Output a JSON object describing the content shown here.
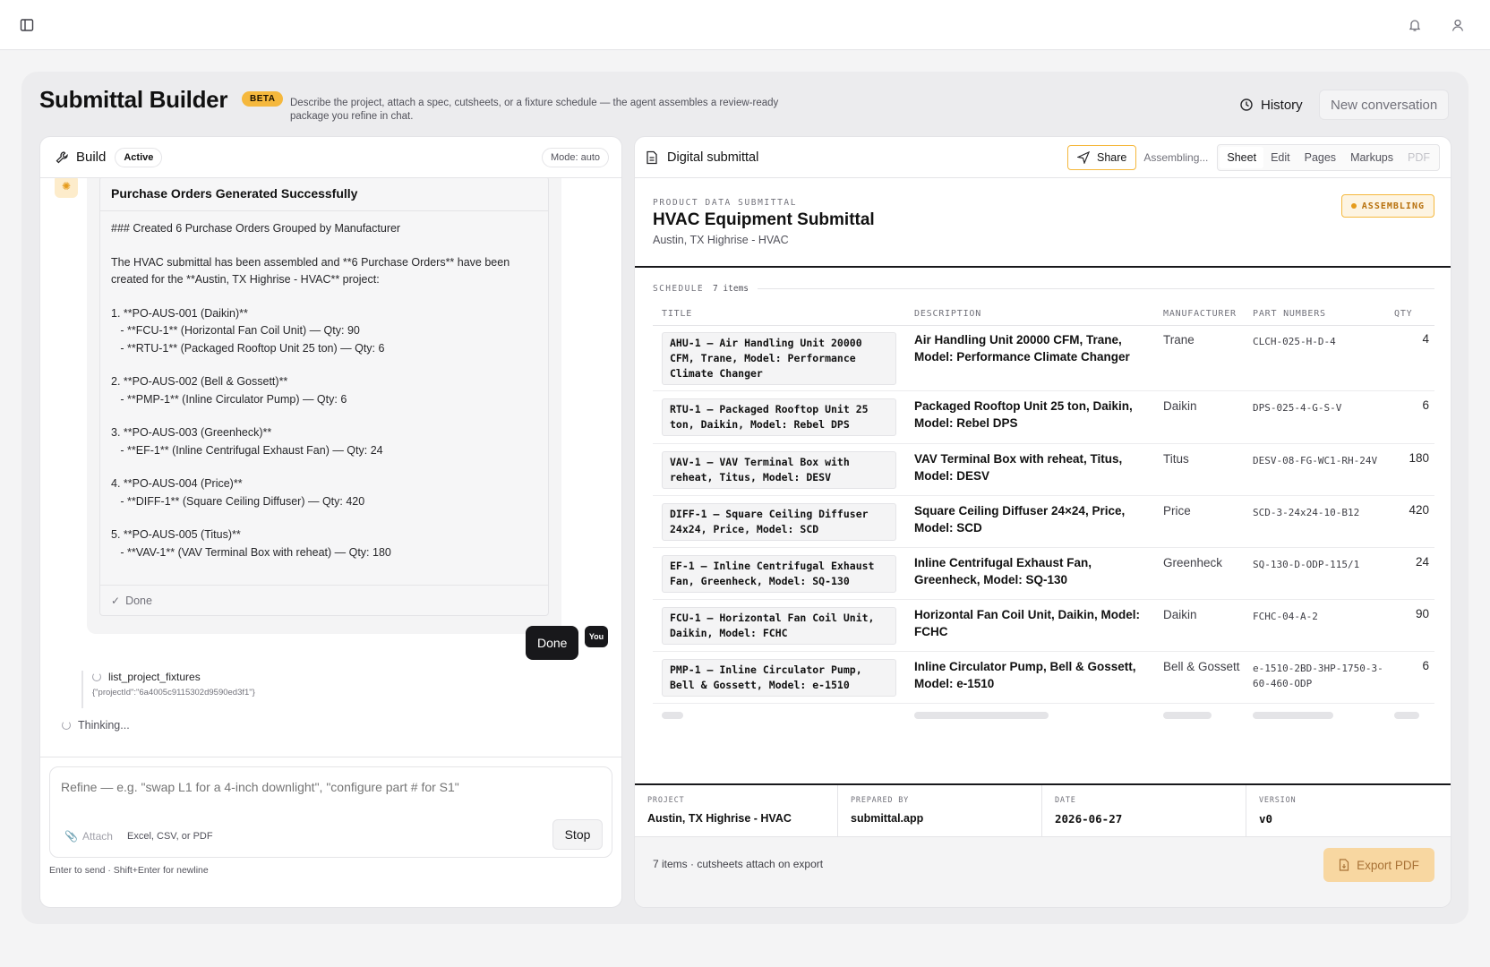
{
  "header": {
    "title": "Submittal Builder",
    "badge": "BETA",
    "description": "Describe the project, attach a spec, cutsheets, or a fixture schedule — the agent assembles a review-ready package you refine in chat.",
    "history_label": "History",
    "new_conversation_label": "New conversation"
  },
  "build": {
    "title": "Build",
    "status": "Active",
    "mode": "Mode: auto",
    "card_title": "Purchase Orders Generated Successfully",
    "card_lines": [
      "### Created 6 Purchase Orders Grouped by Manufacturer",
      "",
      "The HVAC submittal has been assembled and **6 Purchase Orders** have been",
      "created for the **Austin, TX Highrise - HVAC** project:",
      "",
      "1. **PO-AUS-001 (Daikin)**",
      "   - **FCU-1** (Horizontal Fan Coil Unit) — Qty: 90",
      "   - **RTU-1** (Packaged Rooftop Unit 25 ton) — Qty: 6",
      "",
      "2. **PO-AUS-002 (Bell & Gossett)**",
      "   - **PMP-1** (Inline Circulator Pump) — Qty: 6",
      "",
      "3. **PO-AUS-003 (Greenheck)**",
      "   - **EF-1** (Inline Centrifugal Exhaust Fan) — Qty: 24",
      "",
      "4. **PO-AUS-004 (Price)**",
      "   - **DIFF-1** (Square Ceiling Diffuser) — Qty: 420",
      "",
      "5. **PO-AUS-005 (Titus)**",
      "   - **VAV-1** (VAV Terminal Box with reheat) — Qty: 180"
    ],
    "card_footer": "Done",
    "user_message": "Done",
    "user_avatar": "You",
    "tool_name": "list_project_fixtures",
    "tool_args": "{\"projectId\":\"6a4005c9115302d9590ed3f1\"}",
    "thinking": "Thinking...",
    "input_placeholder": "Refine — e.g. \"swap L1 for a 4-inch downlight\", \"configure part # for S1\"",
    "attach_label": "Attach",
    "attach_hint": "Excel, CSV, or PDF",
    "stop_label": "Stop",
    "footer_hint": "Enter to send · Shift+Enter for newline"
  },
  "submittal": {
    "title": "Digital submittal",
    "share_label": "Share",
    "assembling_label": "Assembling...",
    "tabs": [
      "Sheet",
      "Edit",
      "Pages",
      "Markups",
      "PDF"
    ],
    "kicker": "PRODUCT DATA SUBMITTAL",
    "doc_title": "HVAC Equipment Submittal",
    "doc_subtitle": "Austin, TX Highrise - HVAC",
    "status_badge": "ASSEMBLING",
    "schedule_label": "SCHEDULE",
    "schedule_count": "7 items",
    "columns": [
      "TITLE",
      "DESCRIPTION",
      "MANUFACTURER",
      "PART NUMBERS",
      "QTY"
    ],
    "rows": [
      {
        "title": "AHU-1 — Air Handling Unit 20000 CFM, Trane, Model: Performance Climate Changer",
        "description": "Air Handling Unit 20000 CFM, Trane, Model: Performance Climate Changer",
        "manufacturer": "Trane",
        "part": "CLCH-025-H-D-4",
        "qty": "4"
      },
      {
        "title": "RTU-1 — Packaged Rooftop Unit 25 ton, Daikin, Model: Rebel DPS",
        "description": "Packaged Rooftop Unit 25 ton, Daikin, Model: Rebel DPS",
        "manufacturer": "Daikin",
        "part": "DPS-025-4-G-S-V",
        "qty": "6"
      },
      {
        "title": "VAV-1 — VAV Terminal Box with reheat, Titus, Model: DESV",
        "description": "VAV Terminal Box with reheat, Titus, Model: DESV",
        "manufacturer": "Titus",
        "part": "DESV-08-FG-WC1-RH-24V",
        "qty": "180"
      },
      {
        "title": "DIFF-1 — Square Ceiling Diffuser 24x24, Price, Model: SCD",
        "description": "Square Ceiling Diffuser 24×24, Price, Model: SCD",
        "manufacturer": "Price",
        "part": "SCD-3-24x24-10-B12",
        "qty": "420"
      },
      {
        "title": "EF-1 — Inline Centrifugal Exhaust Fan, Greenheck, Model: SQ-130",
        "description": "Inline Centrifugal Exhaust Fan, Greenheck, Model: SQ-130",
        "manufacturer": "Greenheck",
        "part": "SQ-130-D-ODP-115/1",
        "qty": "24"
      },
      {
        "title": "FCU-1 — Horizontal Fan Coil Unit, Daikin, Model: FCHC",
        "description": "Horizontal Fan Coil Unit, Daikin, Model: FCHC",
        "manufacturer": "Daikin",
        "part": "FCHC-04-A-2",
        "qty": "90"
      },
      {
        "title": "PMP-1 — Inline Circulator Pump, Bell & Gossett, Model: e-1510",
        "description": "Inline Circulator Pump, Bell & Gossett, Model: e-1510",
        "manufacturer": "Bell & Gossett",
        "part": "e-1510-2BD-3HP-1750-3-60-460-ODP",
        "qty": "6"
      }
    ],
    "meta": [
      {
        "label": "PROJECT",
        "value": "Austin, TX Highrise - HVAC"
      },
      {
        "label": "PREPARED BY",
        "value": "submittal.app"
      },
      {
        "label": "DATE",
        "value": "2026-06-27"
      },
      {
        "label": "VERSION",
        "value": "v0"
      }
    ],
    "footer_note": "7 items · cutsheets attach on export",
    "export_label": "Export PDF"
  },
  "colors": {
    "accent": "#f5b83d",
    "ink": "#18181b"
  }
}
